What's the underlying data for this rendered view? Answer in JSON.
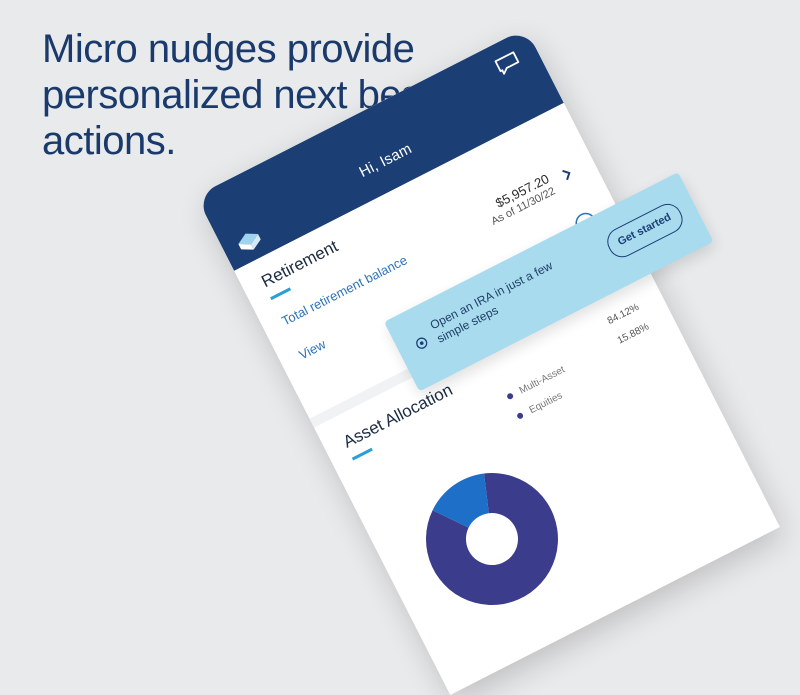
{
  "headline": "Micro nudges provide personalized next best actions.",
  "phone": {
    "greeting": "Hi, Isam",
    "retirement": {
      "title": "Retirement",
      "balance_label": "Total retirement balance",
      "balance_value": "$5,957.20",
      "balance_date": "As of 11/30/22",
      "view_link": "View"
    },
    "asset_allocation": {
      "title": "Asset Allocation",
      "legend": [
        {
          "label": "Multi-Asset",
          "pct": "84.12%",
          "color": "#3b3d8c"
        },
        {
          "label": "Equities",
          "pct": "15.88%",
          "color": "#1e6fc8"
        }
      ]
    }
  },
  "nudge": {
    "text": "Open an IRA in just a few simple steps",
    "button": "Get started"
  },
  "chart_data": {
    "type": "pie",
    "categories": [
      "Multi-Asset",
      "Equities"
    ],
    "values": [
      84.12,
      15.88
    ],
    "colors": [
      "#3b3d8c",
      "#1e6fc8"
    ]
  },
  "colors": {
    "navy": "#1b3f74",
    "accent": "#2a9fd6",
    "nudge_bg": "#a9dbef",
    "background": "#e9eaec"
  }
}
